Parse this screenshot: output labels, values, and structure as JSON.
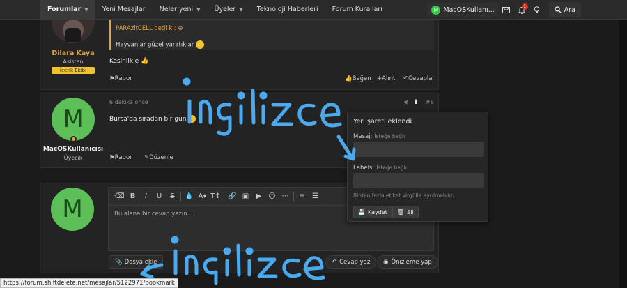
{
  "nav": {
    "tabs": [
      {
        "label": "Forumlar",
        "dropdown": true
      },
      {
        "label": "Yeni Mesajlar",
        "dropdown": false
      },
      {
        "label": "Neler yeni",
        "dropdown": true
      },
      {
        "label": "Üyeler",
        "dropdown": true
      },
      {
        "label": "Teknoloji Haberleri",
        "dropdown": false
      },
      {
        "label": "Forum Kuralları",
        "dropdown": false
      }
    ],
    "user": "MacOSKullanı...",
    "user_initial": "M",
    "alert_count": "1",
    "search_label": "Ara"
  },
  "post1": {
    "username": "Dilara Kaya",
    "role": "Asistan",
    "tag": "İçerik Ekibi",
    "quote_author": "PARAzitCELL dedi ki:",
    "quote_text": "Hayvanlar güzel yaratıklar",
    "body": "Kesinlikle",
    "actions": {
      "report": "Rapor",
      "like": "Beğen",
      "quote": "Alıntı",
      "reply": "Cevapla"
    }
  },
  "post2": {
    "time": "6 dakika önce",
    "number": "#8",
    "body": "Bursa'da sıradan bir gün",
    "username": "MacOSKullanıcısı",
    "initial": "M",
    "role": "Üyecik",
    "actions": {
      "report": "Rapor",
      "edit": "Düzenle"
    }
  },
  "bookmark_popup": {
    "title": "Yer işareti eklendi",
    "message_label": "Mesaj:",
    "message_hint": "İsteğe bağlı",
    "labels_label": "Labels:",
    "labels_hint": "İsteğe bağlı",
    "help": "Birden fazla etiket virgülle ayrılmalıdır.",
    "save": "Kaydet",
    "delete": "Sil"
  },
  "reply_box": {
    "initial": "M",
    "placeholder": "Bu alana bir cevap yazın...",
    "attach": "Dosya ekle",
    "reply_btn": "Cevap yaz",
    "preview_btn": "Önizleme yap"
  },
  "status_url": "https://forum.shiftdelete.net/mesajlar/5122971/bookmark",
  "annotations": [
    "ingilizce",
    "ingilizce"
  ],
  "colors": {
    "accent": "#e4a23b",
    "avatar_green": "#5cbf57",
    "annotation_blue": "#4aaaf0",
    "tag_yellow": "#f3c32a"
  }
}
